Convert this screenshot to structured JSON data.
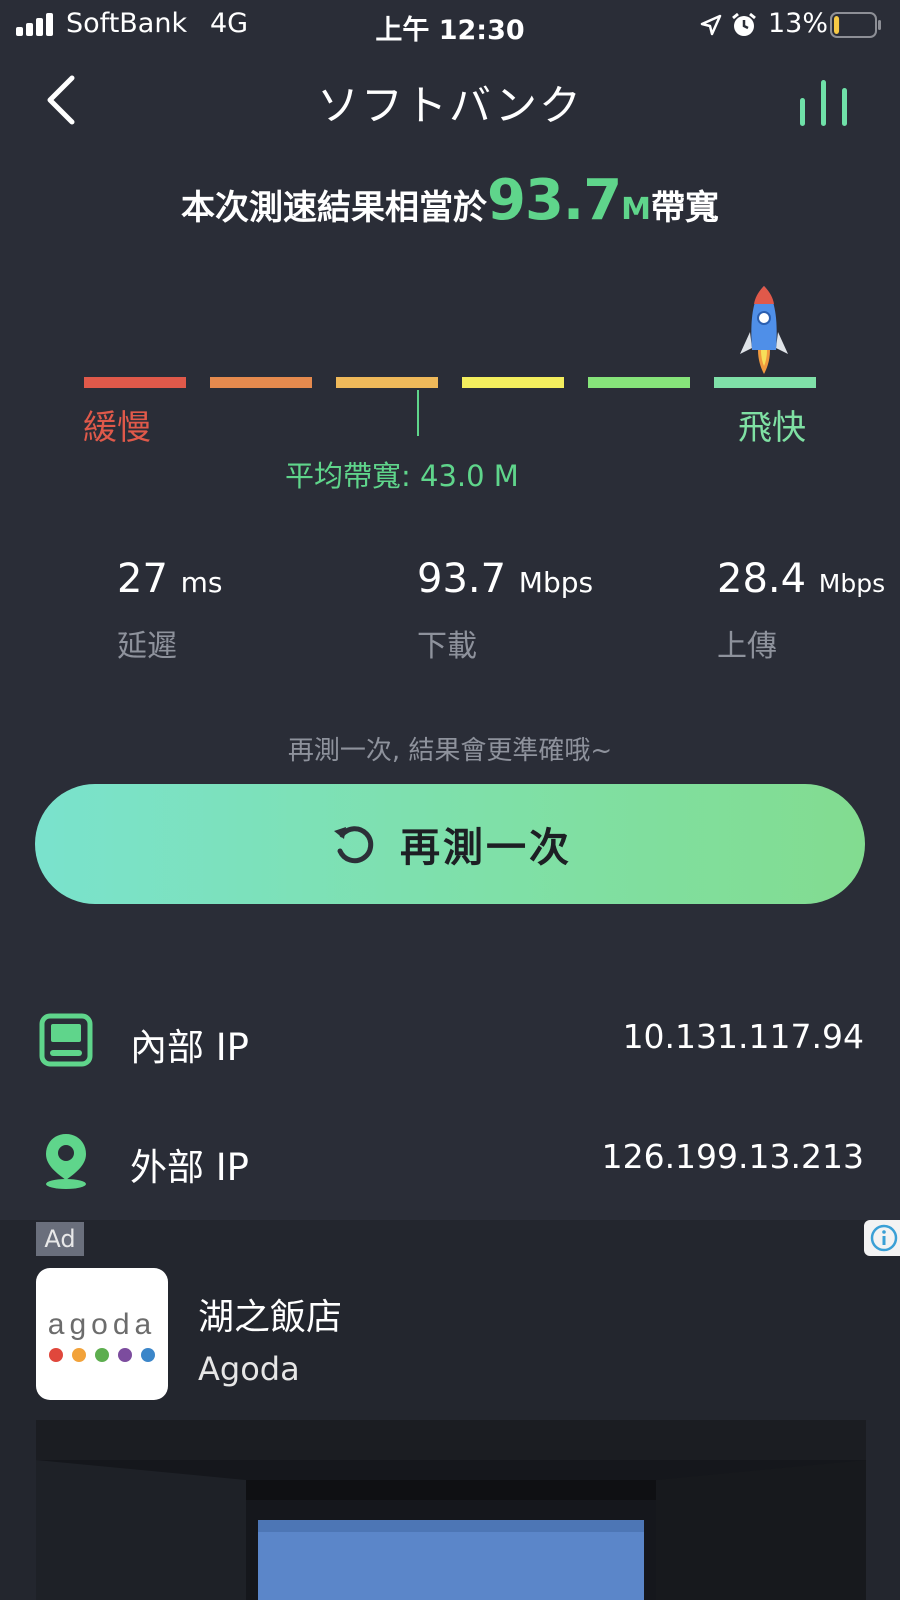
{
  "status_bar": {
    "carrier": "SoftBank",
    "network": "4G",
    "time": "上午 12:30",
    "battery_percent": "13%",
    "battery_level": 0.13,
    "icons": [
      "signal-icon",
      "location-arrow-icon",
      "alarm-clock-icon",
      "battery-icon"
    ]
  },
  "header": {
    "title": "ソフトバンク",
    "back_icon": "chevron-left-icon",
    "right_icon": "bars-icon"
  },
  "result": {
    "prefix": "本次測速結果相當於",
    "value": "93.7",
    "unit": "M",
    "suffix": "帶寬"
  },
  "meter": {
    "slow_label": "緩慢",
    "fast_label": "飛快",
    "average_label": "平均帶寬: 43.0 M",
    "segment_colors": [
      "#e0594a",
      "#e58a4e",
      "#efb95a",
      "#f4ee5e",
      "#86e47a",
      "#7fe0a8"
    ],
    "rocket_icon": "rocket-icon"
  },
  "stats": [
    {
      "value": "27",
      "unit": "ms",
      "label": "延遲"
    },
    {
      "value": "93.7",
      "unit": "Mbps",
      "label": "下載"
    },
    {
      "value": "28.4",
      "unit": "Mbps",
      "label": "上傳"
    }
  ],
  "hint": "再測一次, 結果會更準確哦~",
  "retest_button": {
    "label": "再測一次",
    "icon": "refresh-icon"
  },
  "ip": {
    "internal": {
      "label": "內部 IP",
      "value": "10.131.117.94",
      "icon": "device-icon"
    },
    "external": {
      "label": "外部 IP",
      "value": "126.199.13.213",
      "icon": "location-pin-icon"
    }
  },
  "ad": {
    "badge": "Ad",
    "logo_text": "agoda",
    "logo_dot_colors": [
      "#e0473c",
      "#f2a23a",
      "#5dae4f",
      "#7c4c9e",
      "#3b86c9"
    ],
    "title": "湖之飯店",
    "advertiser": "Agoda",
    "info_icon": "info-icon"
  },
  "colors": {
    "background": "#2a2d37",
    "accent_green": "#5fd58b",
    "muted_text": "#8e929c"
  }
}
